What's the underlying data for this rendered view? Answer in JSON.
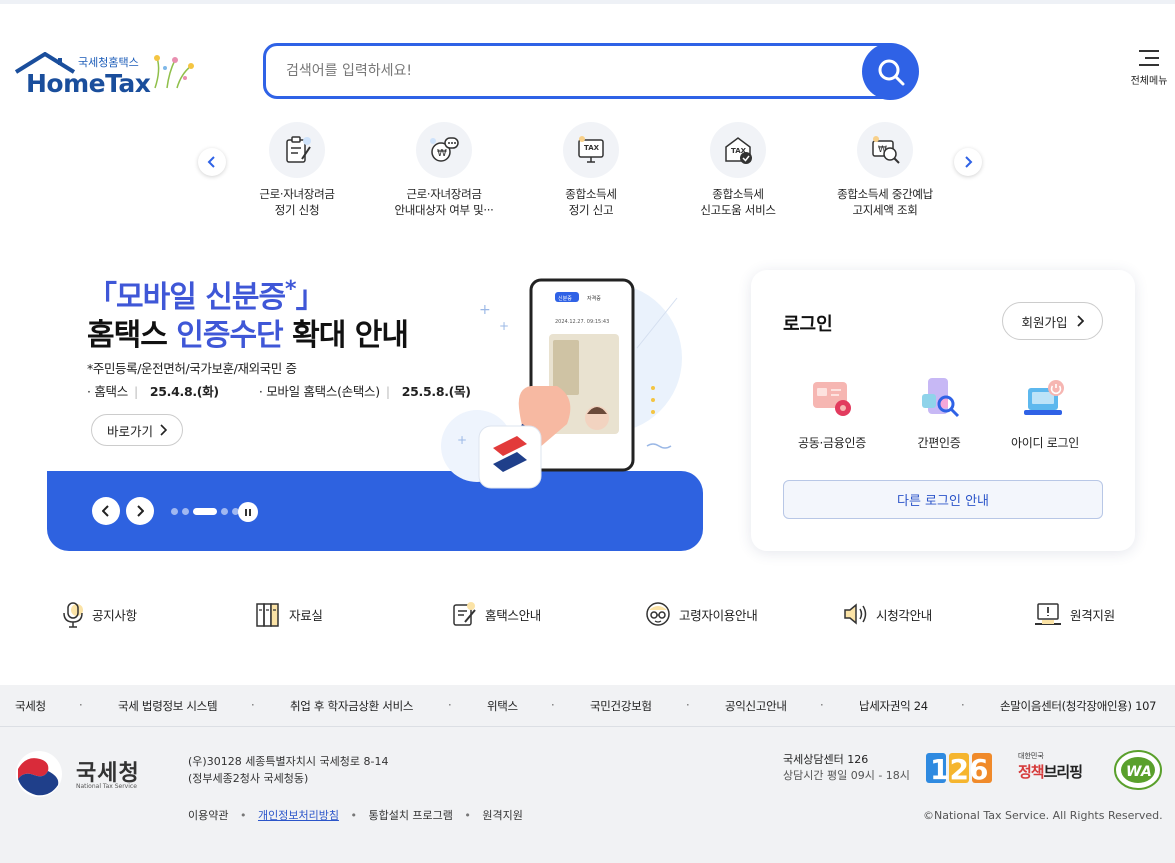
{
  "header": {
    "logo_brand": "국세청홈택스",
    "logo_main": "HomeTax",
    "search_placeholder": "검색어를 입력하세요!",
    "menu_label": "전체메뉴"
  },
  "quick_menu": [
    {
      "line1": "근로·자녀장려금",
      "line2": "정기 신청",
      "icon": "document-pen-icon"
    },
    {
      "line1": "근로·자녀장려금",
      "line2": "안내대상자 여부 및···",
      "icon": "won-chat-icon"
    },
    {
      "line1": "종합소득세",
      "line2": "정기 신고",
      "icon": "tax-monitor-icon"
    },
    {
      "line1": "종합소득세",
      "line2": "신고도움 서비스",
      "icon": "tax-check-icon"
    },
    {
      "line1": "종합소득세 중간예납",
      "line2": "고지세액 조회",
      "icon": "won-search-icon"
    }
  ],
  "banner": {
    "title_open": "「모바일 신분증",
    "title_star": "*",
    "title_close": "」",
    "title2_a": "홈택스 ",
    "title2_hl": "인증수단",
    "title2_b": " 확대 안내",
    "subtitle": "*주민등록/운전면허/국가보훈/재외국민 증",
    "date1_label": "· 홈택스",
    "date1_value": "25.4.8.(화)",
    "date2_label": "· 모바일 홈택스(손택스)",
    "date2_value": "25.5.8.(목)",
    "go_label": "바로가기",
    "phone_tab1": "신분증",
    "phone_tab2": "자격증",
    "phone_time": "2024.12.27. 09:15:43",
    "slide_count": 5,
    "active_slide": 3
  },
  "login": {
    "title": "로그인",
    "join_label": "회원가입",
    "options": [
      {
        "label": "공동·금융인증",
        "icon": "certificate-card-icon"
      },
      {
        "label": "간편인증",
        "icon": "simple-auth-icon"
      },
      {
        "label": "아이디 로그인",
        "icon": "id-login-icon"
      }
    ],
    "other_label": "다른 로그인 안내"
  },
  "shortcuts": [
    {
      "label": "공지사항",
      "icon": "microphone-icon"
    },
    {
      "label": "자료실",
      "icon": "library-icon"
    },
    {
      "label": "홈택스안내",
      "icon": "guide-edit-icon"
    },
    {
      "label": "고령자이용안내",
      "icon": "senior-glasses-icon"
    },
    {
      "label": "시청각안내",
      "icon": "speaker-icon"
    },
    {
      "label": "원격지원",
      "icon": "remote-support-icon"
    }
  ],
  "footer": {
    "links": [
      "국세청",
      "국세 법령정보 시스템",
      "취업 후 학자금상환 서비스",
      "위택스",
      "국민건강보험",
      "공익신고안내",
      "납세자권익 24",
      "손말이음센터(청각장애인용) 107"
    ],
    "org_name": "국세청",
    "org_eng": "National Tax Service",
    "address1": "(우)30128 세종특별자치시 국세청로 8-14",
    "address2": "(정부세종2청사 국세청동)",
    "bottom_links": [
      "이용약관",
      "개인정보처리방침",
      "통합설치 프로그램",
      "원격지원"
    ],
    "center_name": "국세상담센터 126",
    "center_hours": "상담시간 평일 09시 - 18시",
    "badge_number": "126",
    "policy_small": "대한민국",
    "policy_big_a": "정책",
    "policy_big_b": "브리핑",
    "wa_label": "WA",
    "copyright": "©National Tax Service. All Rights Reserved."
  },
  "colors": {
    "primary": "#2f62e6",
    "banner_blue": "#2e62e0",
    "title_blue": "#3f57d7",
    "footer_bg": "#f1f2f4"
  }
}
